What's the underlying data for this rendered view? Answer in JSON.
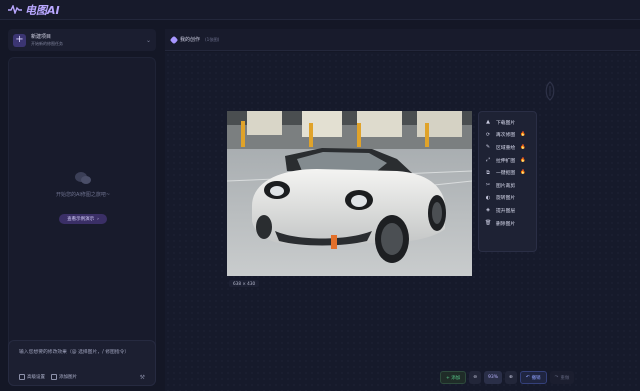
{
  "app": {
    "logo_text": "电图AI",
    "brand_color": "#b9a7ff"
  },
  "sidebar": {
    "new_project_title": "新建项目",
    "new_project_subtitle": "开始新的修图任务",
    "empty_text": "开始您的AI修图之旅吧~",
    "example_button": "查看示例演示",
    "composer_placeholder": "输入您想要的修改效果（@ 选择图片，/ 修图指令）",
    "advanced_settings": "高级设置",
    "add_image": "添加图片"
  },
  "main": {
    "title": "我的创作",
    "count": "(1张图)",
    "image_dimensions": "638 × 430"
  },
  "tools": [
    {
      "label": "下载图片",
      "icon": "download-icon",
      "glyph": "▲",
      "hot": false
    },
    {
      "label": "再次修图",
      "icon": "retouch-icon",
      "glyph": "⟳",
      "hot": true
    },
    {
      "label": "区域重绘",
      "icon": "brush-icon",
      "glyph": "✎",
      "hot": true
    },
    {
      "label": "拉伸扩图",
      "icon": "expand-icon",
      "glyph": "⤢",
      "hot": true
    },
    {
      "label": "一键抠图",
      "icon": "cutout-icon",
      "glyph": "⧉",
      "hot": true
    },
    {
      "label": "图片裁剪",
      "icon": "crop-icon",
      "glyph": "✂",
      "hot": false
    },
    {
      "label": "旋转图片",
      "icon": "rotate-icon",
      "glyph": "◐",
      "hot": false
    },
    {
      "label": "提升图层",
      "icon": "layer-up-icon",
      "glyph": "◈",
      "hot": false
    },
    {
      "label": "删除图片",
      "icon": "delete-icon",
      "glyph": "🗑",
      "hot": false
    }
  ],
  "bottom": {
    "add": "+ 添加",
    "zoom_level": "93%",
    "undo": "撤销",
    "redo": "重做"
  }
}
